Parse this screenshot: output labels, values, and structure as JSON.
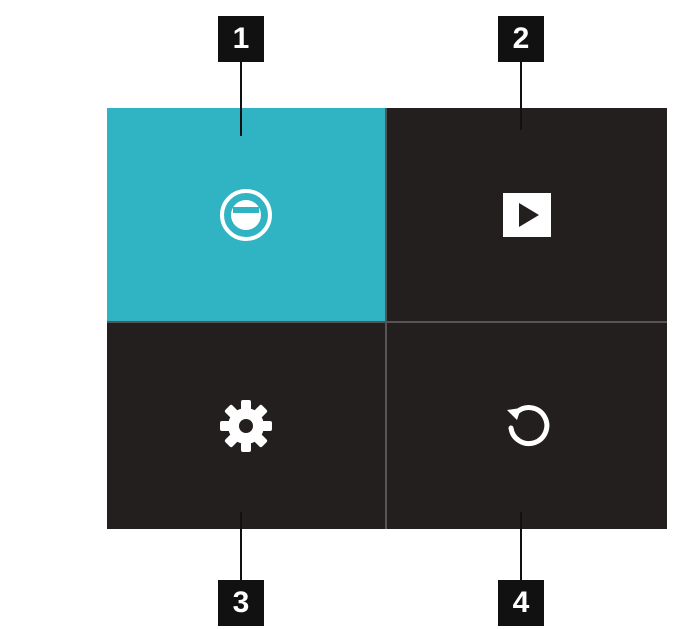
{
  "callouts": [
    "1",
    "2",
    "3",
    "4"
  ],
  "tiles": [
    {
      "icon": "camera-mode-icon",
      "active": true
    },
    {
      "icon": "playback-icon",
      "active": false
    },
    {
      "icon": "settings-gear-icon",
      "active": false
    },
    {
      "icon": "refresh-icon",
      "active": false
    }
  ],
  "colors": {
    "active_tile": "#30b3c2",
    "tile": "#221f1e",
    "grid_line": "#555555",
    "callout_badge": "#111111",
    "icon": "#ffffff"
  }
}
